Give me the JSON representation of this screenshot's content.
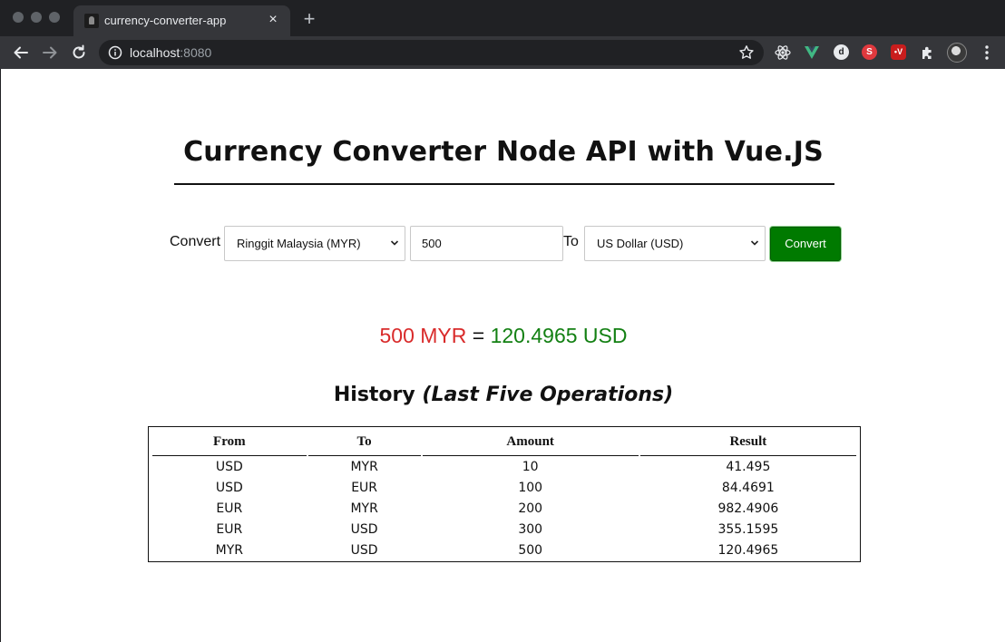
{
  "browser": {
    "tab_title": "currency-converter-app",
    "tab_close": "×",
    "new_tab": "+",
    "url_host": "localhost",
    "url_port": ":8080",
    "extensions": [
      "react-devtools-icon",
      "vue-devtools-icon",
      "d-extension-icon",
      "s-extension-icon",
      "red-extension-icon",
      "puzzle-extensions-icon"
    ],
    "ext_badges": {
      "d": "d",
      "s": "S",
      "v": "•V"
    }
  },
  "page": {
    "title": "Currency Converter Node API with Vue.JS",
    "colors": {
      "convert_button": "#007a00",
      "result_from": "#d92b2b",
      "result_to": "#138013"
    }
  },
  "form": {
    "convert_label": "Convert",
    "from_currency": "Ringgit Malaysia (MYR)",
    "amount": "500",
    "to_label": "To",
    "to_currency": "US Dollar (USD)",
    "convert_button": "Convert"
  },
  "result": {
    "from_text": "500 MYR",
    "equals": " = ",
    "to_text": "120.4965 USD"
  },
  "history": {
    "title": "History",
    "subtitle": "(Last Five Operations)",
    "columns": [
      "From",
      "To",
      "Amount",
      "Result"
    ],
    "rows": [
      [
        "USD",
        "MYR",
        "10",
        "41.495"
      ],
      [
        "USD",
        "EUR",
        "100",
        "84.4691"
      ],
      [
        "EUR",
        "MYR",
        "200",
        "982.4906"
      ],
      [
        "EUR",
        "USD",
        "300",
        "355.1595"
      ],
      [
        "MYR",
        "USD",
        "500",
        "120.4965"
      ]
    ]
  }
}
